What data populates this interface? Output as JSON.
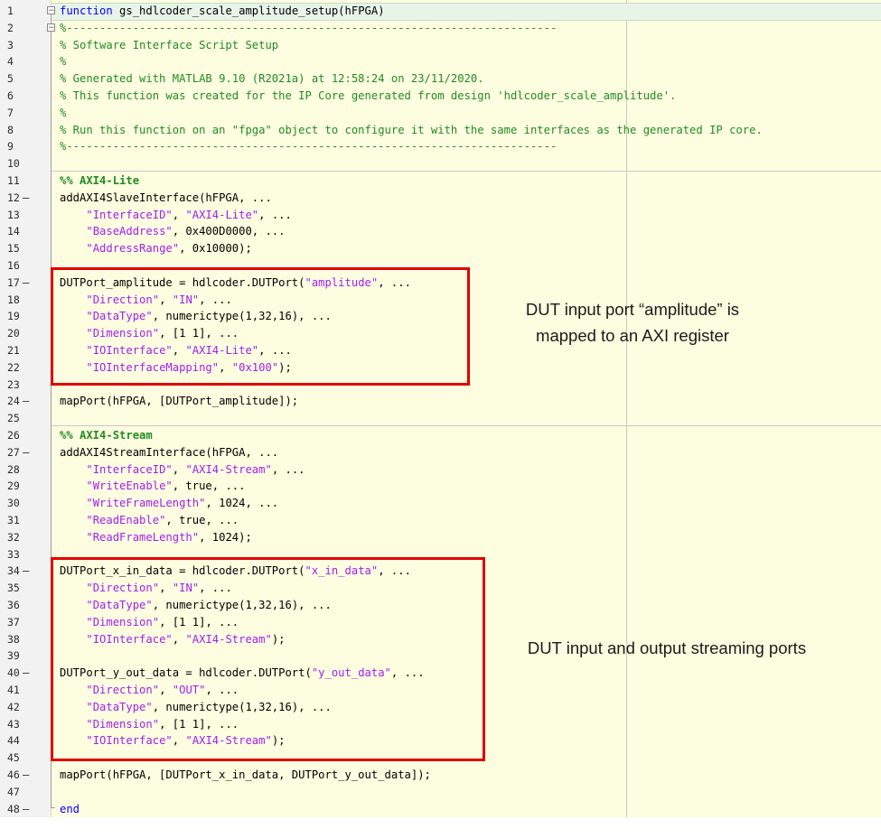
{
  "editor": {
    "lines": [
      {
        "n": "1",
        "dash": false,
        "parts": [
          [
            "kw",
            "function"
          ],
          [
            "tx",
            " gs_hdlcoder_scale_amplitude_setup(hFPGA)"
          ]
        ]
      },
      {
        "n": "2",
        "dash": false,
        "parts": [
          [
            "cm",
            "%--------------------------------------------------------------------------"
          ]
        ]
      },
      {
        "n": "3",
        "dash": false,
        "parts": [
          [
            "cm",
            "% Software Interface Script Setup"
          ]
        ]
      },
      {
        "n": "4",
        "dash": false,
        "parts": [
          [
            "cm",
            "%"
          ]
        ]
      },
      {
        "n": "5",
        "dash": false,
        "parts": [
          [
            "cm",
            "% Generated with MATLAB 9.10 (R2021a) at 12:58:24 on 23/11/2020."
          ]
        ]
      },
      {
        "n": "6",
        "dash": false,
        "parts": [
          [
            "cm",
            "% This function was created for the IP Core generated from design 'hdlcoder_scale_amplitude'."
          ]
        ]
      },
      {
        "n": "7",
        "dash": false,
        "parts": [
          [
            "cm",
            "%"
          ]
        ]
      },
      {
        "n": "8",
        "dash": false,
        "parts": [
          [
            "cm",
            "% Run this function on an \"fpga\" object to configure it with the same interfaces as the generated IP core."
          ]
        ]
      },
      {
        "n": "9",
        "dash": false,
        "parts": [
          [
            "cm",
            "%--------------------------------------------------------------------------"
          ]
        ]
      },
      {
        "n": "10",
        "dash": false,
        "parts": []
      },
      {
        "n": "11",
        "dash": false,
        "parts": [
          [
            "cmb",
            "%% AXI4-Lite"
          ]
        ]
      },
      {
        "n": "12",
        "dash": true,
        "parts": [
          [
            "tx",
            "addAXI4SlaveInterface(hFPGA, ..."
          ]
        ]
      },
      {
        "n": "13",
        "dash": false,
        "parts": [
          [
            "tx",
            "    "
          ],
          [
            "st",
            "\"InterfaceID\""
          ],
          [
            "tx",
            ", "
          ],
          [
            "st",
            "\"AXI4-Lite\""
          ],
          [
            "tx",
            ", ..."
          ]
        ]
      },
      {
        "n": "14",
        "dash": false,
        "parts": [
          [
            "tx",
            "    "
          ],
          [
            "st",
            "\"BaseAddress\""
          ],
          [
            "tx",
            ", 0x400D0000, ..."
          ]
        ]
      },
      {
        "n": "15",
        "dash": false,
        "parts": [
          [
            "tx",
            "    "
          ],
          [
            "st",
            "\"AddressRange\""
          ],
          [
            "tx",
            ", 0x10000);"
          ]
        ]
      },
      {
        "n": "16",
        "dash": false,
        "parts": []
      },
      {
        "n": "17",
        "dash": true,
        "parts": [
          [
            "tx",
            "DUTPort_amplitude = hdlcoder.DUTPort("
          ],
          [
            "st",
            "\"amplitude\""
          ],
          [
            "tx",
            ", ..."
          ]
        ]
      },
      {
        "n": "18",
        "dash": false,
        "parts": [
          [
            "tx",
            "    "
          ],
          [
            "st",
            "\"Direction\""
          ],
          [
            "tx",
            ", "
          ],
          [
            "st",
            "\"IN\""
          ],
          [
            "tx",
            ", ..."
          ]
        ]
      },
      {
        "n": "19",
        "dash": false,
        "parts": [
          [
            "tx",
            "    "
          ],
          [
            "st",
            "\"DataType\""
          ],
          [
            "tx",
            ", numerictype(1,32,16), ..."
          ]
        ]
      },
      {
        "n": "20",
        "dash": false,
        "parts": [
          [
            "tx",
            "    "
          ],
          [
            "st",
            "\"Dimension\""
          ],
          [
            "tx",
            ", [1 1], ..."
          ]
        ]
      },
      {
        "n": "21",
        "dash": false,
        "parts": [
          [
            "tx",
            "    "
          ],
          [
            "st",
            "\"IOInterface\""
          ],
          [
            "tx",
            ", "
          ],
          [
            "st",
            "\"AXI4-Lite\""
          ],
          [
            "tx",
            ", ..."
          ]
        ]
      },
      {
        "n": "22",
        "dash": false,
        "parts": [
          [
            "tx",
            "    "
          ],
          [
            "st",
            "\"IOInterfaceMapping\""
          ],
          [
            "tx",
            ", "
          ],
          [
            "st",
            "\"0x100\""
          ],
          [
            "tx",
            ");"
          ]
        ]
      },
      {
        "n": "23",
        "dash": false,
        "parts": []
      },
      {
        "n": "24",
        "dash": true,
        "parts": [
          [
            "tx",
            "mapPort(hFPGA, [DUTPort_amplitude]);"
          ]
        ]
      },
      {
        "n": "25",
        "dash": false,
        "parts": []
      },
      {
        "n": "26",
        "dash": false,
        "parts": [
          [
            "cmb",
            "%% AXI4-Stream"
          ]
        ]
      },
      {
        "n": "27",
        "dash": true,
        "parts": [
          [
            "tx",
            "addAXI4StreamInterface(hFPGA, ..."
          ]
        ]
      },
      {
        "n": "28",
        "dash": false,
        "parts": [
          [
            "tx",
            "    "
          ],
          [
            "st",
            "\"InterfaceID\""
          ],
          [
            "tx",
            ", "
          ],
          [
            "st",
            "\"AXI4-Stream\""
          ],
          [
            "tx",
            ", ..."
          ]
        ]
      },
      {
        "n": "29",
        "dash": false,
        "parts": [
          [
            "tx",
            "    "
          ],
          [
            "st",
            "\"WriteEnable\""
          ],
          [
            "tx",
            ", true, ..."
          ]
        ]
      },
      {
        "n": "30",
        "dash": false,
        "parts": [
          [
            "tx",
            "    "
          ],
          [
            "st",
            "\"WriteFrameLength\""
          ],
          [
            "tx",
            ", 1024, ..."
          ]
        ]
      },
      {
        "n": "31",
        "dash": false,
        "parts": [
          [
            "tx",
            "    "
          ],
          [
            "st",
            "\"ReadEnable\""
          ],
          [
            "tx",
            ", true, ..."
          ]
        ]
      },
      {
        "n": "32",
        "dash": false,
        "parts": [
          [
            "tx",
            "    "
          ],
          [
            "st",
            "\"ReadFrameLength\""
          ],
          [
            "tx",
            ", 1024);"
          ]
        ]
      },
      {
        "n": "33",
        "dash": false,
        "parts": []
      },
      {
        "n": "34",
        "dash": true,
        "parts": [
          [
            "tx",
            "DUTPort_x_in_data = hdlcoder.DUTPort("
          ],
          [
            "st",
            "\"x_in_data\""
          ],
          [
            "tx",
            ", ..."
          ]
        ]
      },
      {
        "n": "35",
        "dash": false,
        "parts": [
          [
            "tx",
            "    "
          ],
          [
            "st",
            "\"Direction\""
          ],
          [
            "tx",
            ", "
          ],
          [
            "st",
            "\"IN\""
          ],
          [
            "tx",
            ", ..."
          ]
        ]
      },
      {
        "n": "36",
        "dash": false,
        "parts": [
          [
            "tx",
            "    "
          ],
          [
            "st",
            "\"DataType\""
          ],
          [
            "tx",
            ", numerictype(1,32,16), ..."
          ]
        ]
      },
      {
        "n": "37",
        "dash": false,
        "parts": [
          [
            "tx",
            "    "
          ],
          [
            "st",
            "\"Dimension\""
          ],
          [
            "tx",
            ", [1 1], ..."
          ]
        ]
      },
      {
        "n": "38",
        "dash": false,
        "parts": [
          [
            "tx",
            "    "
          ],
          [
            "st",
            "\"IOInterface\""
          ],
          [
            "tx",
            ", "
          ],
          [
            "st",
            "\"AXI4-Stream\""
          ],
          [
            "tx",
            ");"
          ]
        ]
      },
      {
        "n": "39",
        "dash": false,
        "parts": []
      },
      {
        "n": "40",
        "dash": true,
        "parts": [
          [
            "tx",
            "DUTPort_y_out_data = hdlcoder.DUTPort("
          ],
          [
            "st",
            "\"y_out_data\""
          ],
          [
            "tx",
            ", ..."
          ]
        ]
      },
      {
        "n": "41",
        "dash": false,
        "parts": [
          [
            "tx",
            "    "
          ],
          [
            "st",
            "\"Direction\""
          ],
          [
            "tx",
            ", "
          ],
          [
            "st",
            "\"OUT\""
          ],
          [
            "tx",
            ", ..."
          ]
        ]
      },
      {
        "n": "42",
        "dash": false,
        "parts": [
          [
            "tx",
            "    "
          ],
          [
            "st",
            "\"DataType\""
          ],
          [
            "tx",
            ", numerictype(1,32,16), ..."
          ]
        ]
      },
      {
        "n": "43",
        "dash": false,
        "parts": [
          [
            "tx",
            "    "
          ],
          [
            "st",
            "\"Dimension\""
          ],
          [
            "tx",
            ", [1 1], ..."
          ]
        ]
      },
      {
        "n": "44",
        "dash": false,
        "parts": [
          [
            "tx",
            "    "
          ],
          [
            "st",
            "\"IOInterface\""
          ],
          [
            "tx",
            ", "
          ],
          [
            "st",
            "\"AXI4-Stream\""
          ],
          [
            "tx",
            ");"
          ]
        ]
      },
      {
        "n": "45",
        "dash": false,
        "parts": []
      },
      {
        "n": "46",
        "dash": true,
        "parts": [
          [
            "tx",
            "mapPort(hFPGA, [DUTPort_x_in_data, DUTPort_y_out_data]);"
          ]
        ]
      },
      {
        "n": "47",
        "dash": false,
        "parts": []
      },
      {
        "n": "48",
        "dash": true,
        "parts": [
          [
            "kw",
            "end"
          ]
        ]
      }
    ]
  },
  "annotations": {
    "amplitude_note": "DUT input port “amplitude” is\nmapped to an AXI register",
    "streaming_note": "DUT input and output streaming ports"
  },
  "colors": {
    "keyword": "#0000ff",
    "comment": "#228b22",
    "string": "#a020f0",
    "code_background": "#fdfde0",
    "highlight_box": "#e00000"
  },
  "icons": {
    "fold_collapse": "minus-box-icon"
  }
}
